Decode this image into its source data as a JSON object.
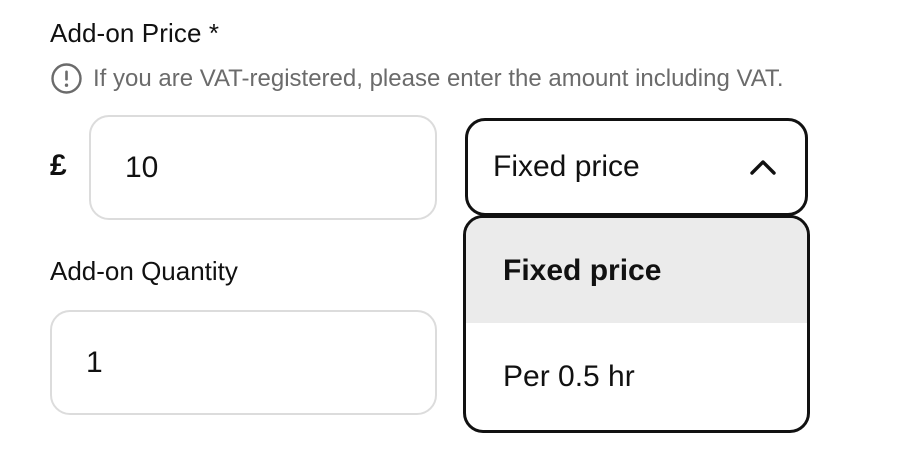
{
  "price": {
    "label": "Add-on Price *",
    "hint": "If you are VAT-registered, please enter the amount including VAT.",
    "hint_icon": "exclamation-circle-icon",
    "currency_symbol": "£",
    "value": "10"
  },
  "pricing_type": {
    "selected": "Fixed price",
    "expanded": true,
    "options": [
      {
        "label": "Fixed price",
        "selected": true
      },
      {
        "label": "Per 0.5 hr",
        "selected": false
      }
    ],
    "toggle_icon": "chevron-up-icon"
  },
  "quantity": {
    "label": "Add-on Quantity",
    "value": "1"
  },
  "colors": {
    "text": "#111111",
    "hint_text": "#6b6b6b",
    "input_border": "#dcdcdc",
    "active_border": "#111111",
    "selected_option_bg": "#ebebeb"
  }
}
